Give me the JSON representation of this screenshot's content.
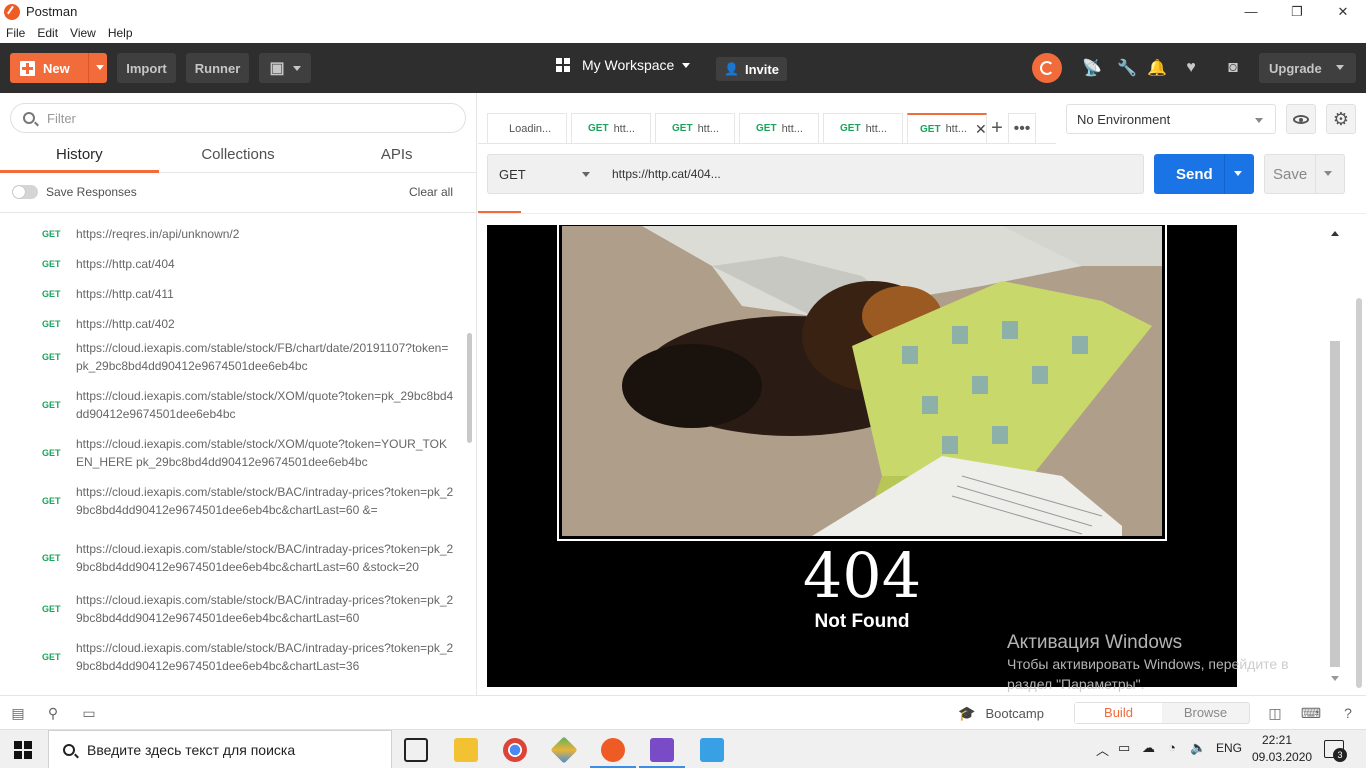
{
  "window": {
    "title": "Postman",
    "controls": [
      "—",
      "❐",
      "✕"
    ]
  },
  "menu": [
    "File",
    "Edit",
    "View",
    "Help"
  ],
  "header": {
    "new_label": "New",
    "import_label": "Import",
    "runner_label": "Runner",
    "workspace_label": "My Workspace",
    "invite_label": "Invite",
    "upgrade_label": "Upgrade",
    "accent_color": "#f26b3a"
  },
  "sidebar": {
    "filter_placeholder": "Filter",
    "tabs": [
      "History",
      "Collections",
      "APIs"
    ],
    "save_responses_label": "Save Responses",
    "clear_all_label": "Clear all",
    "history": [
      {
        "method": "GET",
        "url": "https://reqres.in/api/unknown/2"
      },
      {
        "method": "GET",
        "url": "https://http.cat/404"
      },
      {
        "method": "GET",
        "url": "https://http.cat/411"
      },
      {
        "method": "GET",
        "url": "https://http.cat/402"
      },
      {
        "method": "GET",
        "url": "https://cloud.iexapis.com/stable/stock/FB/chart/date/20191107?token=pk_29bc8bd4dd90412e9674501dee6eb4bc"
      },
      {
        "method": "GET",
        "url": "https://cloud.iexapis.com/stable/stock/XOM/quote?token=pk_29bc8bd4dd90412e9674501dee6eb4bc"
      },
      {
        "method": "GET",
        "url": "https://cloud.iexapis.com/stable/stock/XOM/quote?token=YOUR_TOKEN_HERE pk_29bc8bd4dd90412e9674501dee6eb4bc"
      },
      {
        "method": "GET",
        "url": "https://cloud.iexapis.com/stable/stock/BAC/intraday-prices?token=pk_29bc8bd4dd90412e9674501dee6eb4bc&chartLast=60 &="
      },
      {
        "method": "GET",
        "url": "https://cloud.iexapis.com/stable/stock/BAC/intraday-prices?token=pk_29bc8bd4dd90412e9674501dee6eb4bc&chartLast=60 &stock=20"
      },
      {
        "method": "GET",
        "url": "https://cloud.iexapis.com/stable/stock/BAC/intraday-prices?token=pk_29bc8bd4dd90412e9674501dee6eb4bc&chartLast=60"
      },
      {
        "method": "GET",
        "url": "https://cloud.iexapis.com/stable/stock/BAC/intraday-prices?token=pk_29bc8bd4dd90412e9674501dee6eb4bc&chartLast=36"
      }
    ]
  },
  "tabs": [
    {
      "method": "",
      "label": "Loadin..."
    },
    {
      "method": "GET",
      "label": "htt..."
    },
    {
      "method": "GET",
      "label": "htt..."
    },
    {
      "method": "GET",
      "label": "htt..."
    },
    {
      "method": "GET",
      "label": "htt..."
    },
    {
      "method": "GET",
      "label": "htt...",
      "active": true
    }
  ],
  "environment": {
    "selected": "No Environment"
  },
  "request": {
    "method": "GET",
    "url": "https://http.cat/404...",
    "send_label": "Send",
    "save_label": "Save",
    "send_color": "#1a74e5"
  },
  "response": {
    "code": "404",
    "text": "Not Found"
  },
  "watermark": {
    "title": "Активация Windows",
    "subtitle": "Чтобы активировать Windows, перейдите в раздел \"Параметры\"."
  },
  "statusbar": {
    "bootcamp_label": "Bootcamp",
    "build_label": "Build",
    "browse_label": "Browse"
  },
  "taskbar": {
    "search_placeholder": "Введите здесь текст для поиска",
    "language": "ENG",
    "time": "22:21",
    "date": "09.03.2020",
    "notifications": "3"
  }
}
